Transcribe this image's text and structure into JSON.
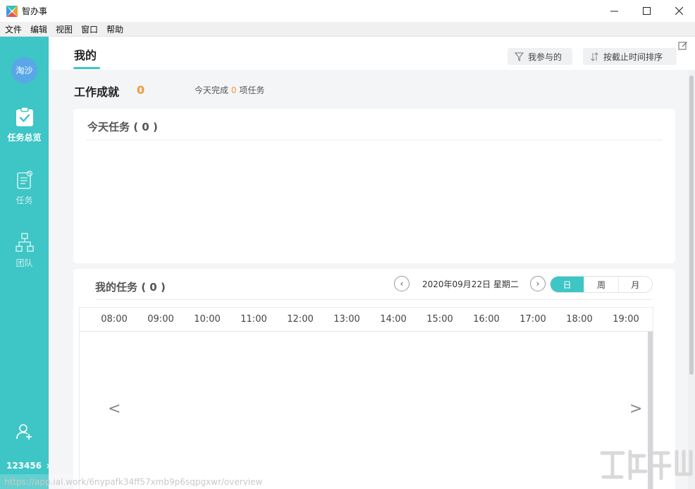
{
  "window": {
    "title": "智办事",
    "minimize_symbol": "—",
    "maximize_symbol": "☐",
    "close_symbol": "✕"
  },
  "menu": [
    "文件",
    "编辑",
    "视图",
    "窗口",
    "帮助"
  ],
  "sidebar": {
    "avatar_text": "淘沙",
    "items": [
      {
        "label": "任务总览",
        "icon": "clipboard-check-icon",
        "active": true
      },
      {
        "label": "任务",
        "icon": "task-list-icon",
        "active": false
      },
      {
        "label": "团队",
        "icon": "team-tree-icon",
        "active": false
      }
    ],
    "bottom_icon": "add-user-icon",
    "user_id": "123456",
    "user_arrow": "›"
  },
  "header": {
    "tab_label": "我的",
    "filter_participated": "我参与的",
    "sort_deadline": "按截止时间排序",
    "edit_icon": "edit-icon"
  },
  "achievement": {
    "title": "工作成就",
    "count": "0",
    "summary_prefix": "今天完成",
    "summary_count": "0",
    "summary_suffix": "项任务"
  },
  "today_tasks": {
    "title": "今天任务 ( 0 )"
  },
  "my_tasks": {
    "title": "我的任务 ( 0 )",
    "date": "2020年09月22日 星期二",
    "prev_symbol": "‹",
    "next_symbol": "›",
    "view_modes": [
      {
        "label": "日",
        "active": true
      },
      {
        "label": "周",
        "active": false
      },
      {
        "label": "月",
        "active": false
      }
    ],
    "hours": [
      "08:00",
      "09:00",
      "10:00",
      "11:00",
      "12:00",
      "13:00",
      "14:00",
      "15:00",
      "16:00",
      "17:00",
      "18:00",
      "19:00"
    ],
    "left_arrow": "<",
    "right_arrow": ">"
  },
  "status_url": "https://app.ial.work/6nypafk34ff57xmb9p6sqpgxwr/overview",
  "colors": {
    "accent": "#3ec5c5",
    "highlight": "#f3993b",
    "avatar": "#5aa7e8"
  }
}
